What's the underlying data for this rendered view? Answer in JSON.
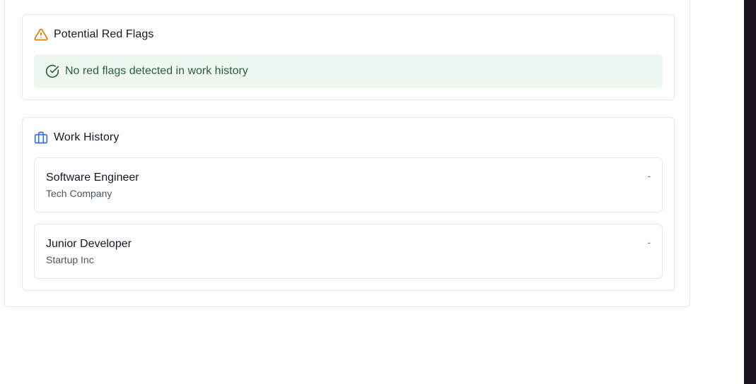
{
  "red_flags": {
    "title": "Potential Red Flags",
    "icon": "warning-triangle-icon",
    "status_icon": "check-circle-icon",
    "status_message": "No red flags detected in work history"
  },
  "work_history": {
    "title": "Work History",
    "icon": "briefcase-icon",
    "jobs": [
      {
        "title": "Software Engineer",
        "company": "Tech Company",
        "dates": "-"
      },
      {
        "title": "Junior Developer",
        "company": "Startup Inc",
        "dates": "-"
      }
    ]
  },
  "colors": {
    "warning": "#d97706",
    "success": "#2f5d3a",
    "success_bg": "#eef8f1",
    "info": "#3b6fd6"
  }
}
